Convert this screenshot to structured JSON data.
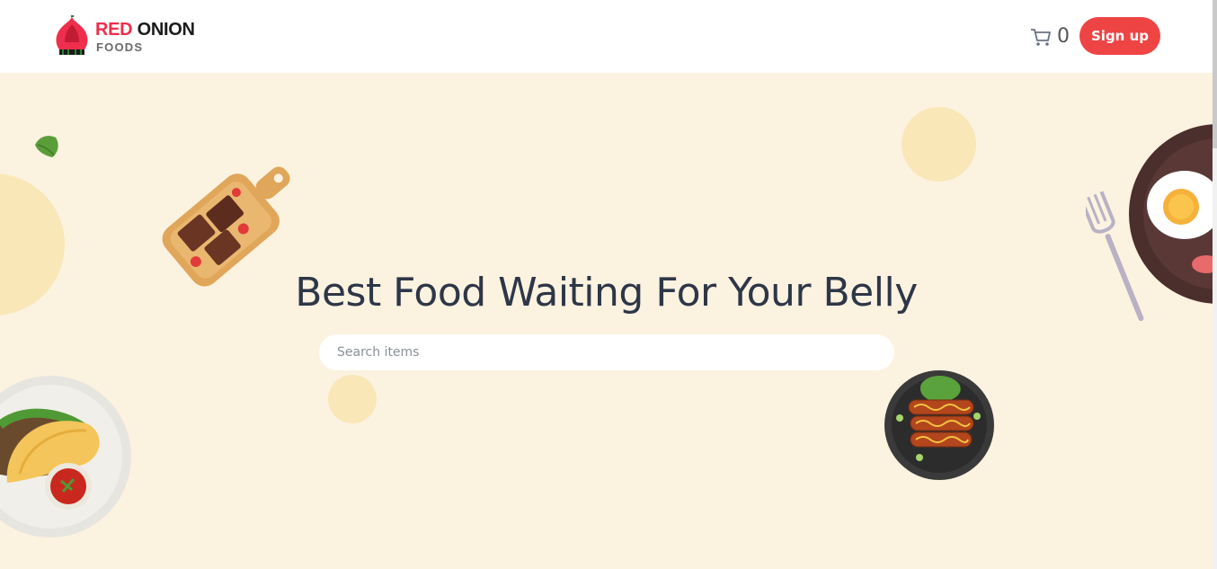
{
  "brand": {
    "name_red": "RED",
    "name_dark": "ONION",
    "subtitle": "FOODS",
    "accent": "#ee2e4c"
  },
  "header": {
    "cart_icon": "cart-icon",
    "cart_count": "0",
    "signup_label": "Sign up",
    "signup_color": "#ef4444"
  },
  "hero": {
    "headline": "Best Food Waiting For Your Belly",
    "search_placeholder": "Search items",
    "background": "#fcf2e0",
    "decor_icons": [
      "leaf-icon",
      "brownie-board-icon",
      "fork-icon",
      "egg-plate-icon",
      "taco-plate-icon",
      "sausage-plate-icon"
    ]
  }
}
